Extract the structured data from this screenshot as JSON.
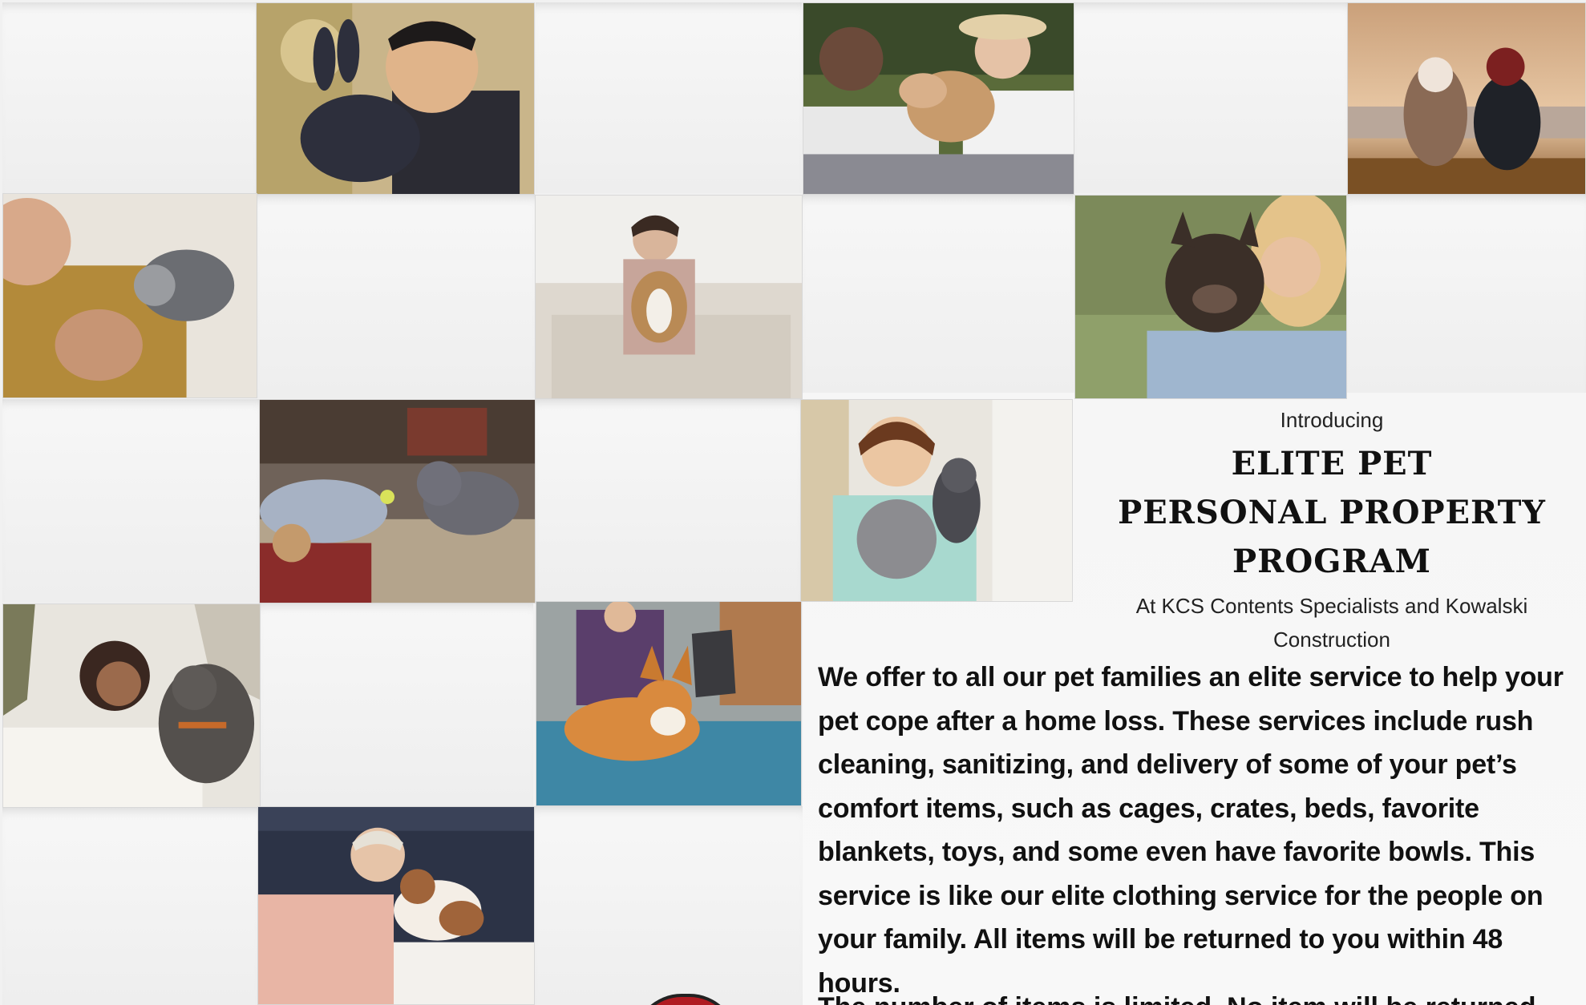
{
  "flyer": {
    "intro": "Introducing",
    "headline_lines": [
      "ELITE PET",
      "PERSONAL PROPERTY",
      "PROGRAM"
    ],
    "subline_lines": [
      "At KCS Contents Specialists and Kowalski",
      "Construction"
    ],
    "body": "We offer to all our pet families an elite service to help your pet cope after a home loss. These services include rush cleaning, sanitizing, and delivery of some of your pet’s comfort items, such as cages, crates, beds, favorite blankets, toys, and some even have favorite bowls. This service is like our elite clothing service for the people on your family. All items will be returned to you within 48 hours.",
    "cut_line": "The number of items is limited. No item will be returned"
  },
  "photos": [
    {
      "name": "photo-boy-with-rabbit"
    },
    {
      "name": "photo-couple-with-dog"
    },
    {
      "name": "photo-woman-dog-sunset"
    },
    {
      "name": "photo-man-with-parrot"
    },
    {
      "name": "photo-woman-beagle-sofa"
    },
    {
      "name": "photo-woman-hugging-french-bulldog"
    },
    {
      "name": "photo-woman-bulldog-floor"
    },
    {
      "name": "photo-boy-with-kittens"
    },
    {
      "name": "photo-woman-with-pitbull"
    },
    {
      "name": "photo-corgi-on-couch"
    },
    {
      "name": "photo-woman-kissing-small-dog"
    }
  ],
  "colors": {
    "background": "#f1f1f1",
    "text": "#111111",
    "logo_red": "#b01c22"
  }
}
